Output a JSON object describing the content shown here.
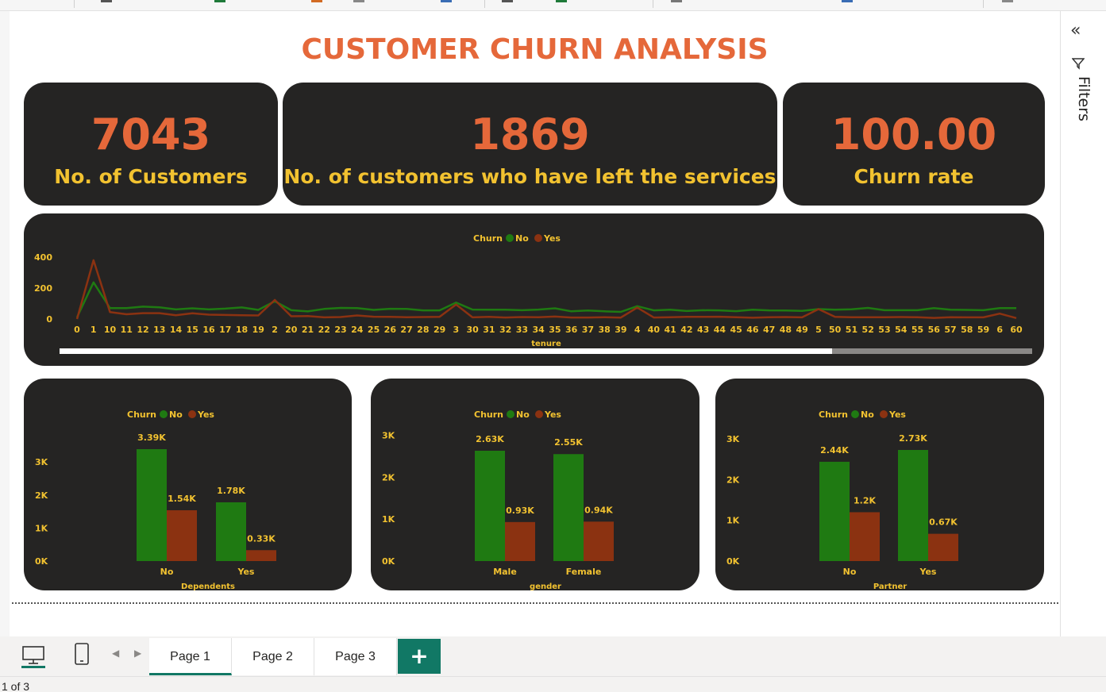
{
  "title": "CUSTOMER CHURN ANALYSIS",
  "kpis": [
    {
      "value": "7043",
      "label": "No. of Customers"
    },
    {
      "value": "1869",
      "label": "No. of customers who have left the services"
    },
    {
      "value": "100.00",
      "label": "Churn rate"
    }
  ],
  "colors": {
    "no": "#1f7a12",
    "yes": "#8b3211",
    "label": "#f2c230",
    "panel": "#252423",
    "title": "#e5683a"
  },
  "legend": {
    "title": "Churn",
    "no": "No",
    "yes": "Yes"
  },
  "filters": {
    "label": "Filters"
  },
  "tabs": [
    "Page 1",
    "Page 2",
    "Page 3"
  ],
  "add_tab": "+",
  "status": "1 of 3",
  "chart_data": [
    {
      "type": "line",
      "xlabel": "tenure",
      "ylabel": "",
      "ylim": [
        0,
        400
      ],
      "yticks": [
        0,
        200,
        400
      ],
      "legend_placement": "top-center",
      "categories": [
        "0",
        "1",
        "10",
        "11",
        "12",
        "13",
        "14",
        "15",
        "16",
        "17",
        "18",
        "19",
        "2",
        "20",
        "21",
        "22",
        "23",
        "24",
        "25",
        "26",
        "27",
        "28",
        "29",
        "3",
        "30",
        "31",
        "32",
        "33",
        "34",
        "35",
        "36",
        "37",
        "38",
        "39",
        "4",
        "40",
        "41",
        "42",
        "43",
        "44",
        "45",
        "46",
        "47",
        "48",
        "49",
        "5",
        "50",
        "51",
        "52",
        "53",
        "54",
        "55",
        "56",
        "57",
        "58",
        "59",
        "6",
        "60"
      ],
      "series": [
        {
          "name": "No",
          "values": [
            11,
            237,
            71,
            71,
            80,
            76,
            62,
            69,
            62,
            67,
            75,
            59,
            115,
            57,
            49,
            65,
            72,
            71,
            59,
            66,
            65,
            56,
            56,
            106,
            61,
            60,
            60,
            57,
            61,
            69,
            50,
            55,
            50,
            46,
            83,
            56,
            60,
            52,
            57,
            56,
            51,
            60,
            56,
            55,
            53,
            64,
            60,
            63,
            72,
            57,
            57,
            57,
            71,
            60,
            59,
            57,
            70,
            70
          ]
        },
        {
          "name": "Yes",
          "values": [
            0,
            380,
            45,
            31,
            38,
            38,
            24,
            37,
            28,
            26,
            24,
            23,
            123,
            18,
            19,
            11,
            13,
            23,
            15,
            14,
            12,
            13,
            14,
            94,
            11,
            14,
            10,
            13,
            12,
            16,
            10,
            10,
            12,
            9,
            74,
            10,
            12,
            14,
            14,
            15,
            12,
            8,
            12,
            13,
            11,
            64,
            14,
            12,
            12,
            12,
            13,
            12,
            7,
            12,
            11,
            11,
            35,
            6
          ]
        }
      ]
    },
    {
      "type": "bar",
      "xlabel": "Dependents",
      "ylabel": "",
      "ylim": [
        0,
        3390
      ],
      "yticks": [
        "0K",
        "1K",
        "2K",
        "3K"
      ],
      "legend_placement": "top-center",
      "categories": [
        "No",
        "Yes"
      ],
      "series": [
        {
          "name": "No",
          "values": [
            3390,
            1780
          ],
          "labels": [
            "3.39K",
            "1.78K"
          ]
        },
        {
          "name": "Yes",
          "values": [
            1540,
            330
          ],
          "labels": [
            "1.54K",
            "0.33K"
          ]
        }
      ]
    },
    {
      "type": "bar",
      "xlabel": "gender",
      "ylabel": "",
      "ylim": [
        0,
        3000
      ],
      "yticks": [
        "0K",
        "1K",
        "2K",
        "3K"
      ],
      "legend_placement": "top-center",
      "categories": [
        "Male",
        "Female"
      ],
      "series": [
        {
          "name": "No",
          "values": [
            2630,
            2550
          ],
          "labels": [
            "2.63K",
            "2.55K"
          ]
        },
        {
          "name": "Yes",
          "values": [
            930,
            940
          ],
          "labels": [
            "0.93K",
            "0.94K"
          ]
        }
      ]
    },
    {
      "type": "bar",
      "xlabel": "Partner",
      "ylabel": "",
      "ylim": [
        0,
        3000
      ],
      "yticks": [
        "0K",
        "1K",
        "2K",
        "3K"
      ],
      "legend_placement": "top-center",
      "categories": [
        "No",
        "Yes"
      ],
      "series": [
        {
          "name": "No",
          "values": [
            2440,
            2730
          ],
          "labels": [
            "2.44K",
            "2.73K"
          ]
        },
        {
          "name": "Yes",
          "values": [
            1200,
            670
          ],
          "labels": [
            "1.2K",
            "0.67K"
          ]
        }
      ]
    }
  ]
}
